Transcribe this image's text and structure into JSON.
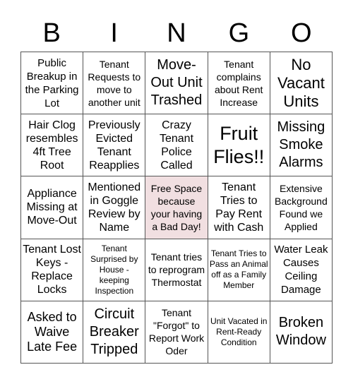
{
  "header": {
    "letters": [
      "B",
      "I",
      "N",
      "G",
      "O"
    ]
  },
  "colors": {
    "free_space_bg": "#f1dfe1",
    "grid_line": "#555555"
  },
  "card": {
    "rows": [
      [
        "Public Breakup in the Parking Lot",
        "Tenant Requests to move to another unit",
        "Move-Out Unit Trashed",
        "Tenant complains about Rent Increase",
        "No Vacant Units"
      ],
      [
        "Hair Clog resembles 4ft Tree Root",
        "Previously Evicted Tenant Reapplies",
        "Crazy Tenant Police Called",
        "Fruit Flies!!",
        "Missing Smoke Alarms"
      ],
      [
        "Appliance Missing at Move-Out",
        "Mentioned in Goggle Review by Name",
        "Free Space because your having a Bad Day!",
        "Tenant Tries to Pay Rent with Cash",
        "Extensive Background Found we Applied"
      ],
      [
        "Tenant Lost Keys - Replace Locks",
        "Tenant Surprised by House - keeping Inspection",
        "Tenant tries to reprogram Thermostat",
        "Tenant Tries to Pass an Animal off as a Family Member",
        "Water Leak Causes Ceiling Damage"
      ],
      [
        "Asked to Waive Late Fee",
        "Circuit Breaker Tripped",
        "Tenant \"Forgot\" to Report Work Oder",
        "Unit Vacated in Rent-Ready Condition",
        "Broken Window"
      ]
    ],
    "free_space": {
      "row": 2,
      "col": 2
    }
  }
}
